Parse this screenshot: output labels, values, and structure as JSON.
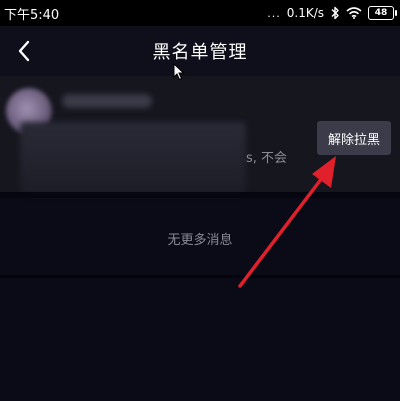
{
  "status_bar": {
    "time": "下午5:40",
    "dots": "...",
    "net_speed": "0.1K/s",
    "battery": "48",
    "icons": [
      "bluetooth-icon",
      "wifi-icon",
      "battery-icon"
    ]
  },
  "header": {
    "title": "黑名单管理",
    "back_icon": "chevron-left-icon"
  },
  "blocked_user": {
    "bio_tail": "s, 不会",
    "unblock_label": "解除拉黑"
  },
  "list_footer": {
    "no_more": "无更多消息"
  },
  "colors": {
    "background": "#0b0b17",
    "row_background": "#16161f",
    "button_background": "#3b3b4a",
    "annotation_arrow": "#e0202a"
  }
}
